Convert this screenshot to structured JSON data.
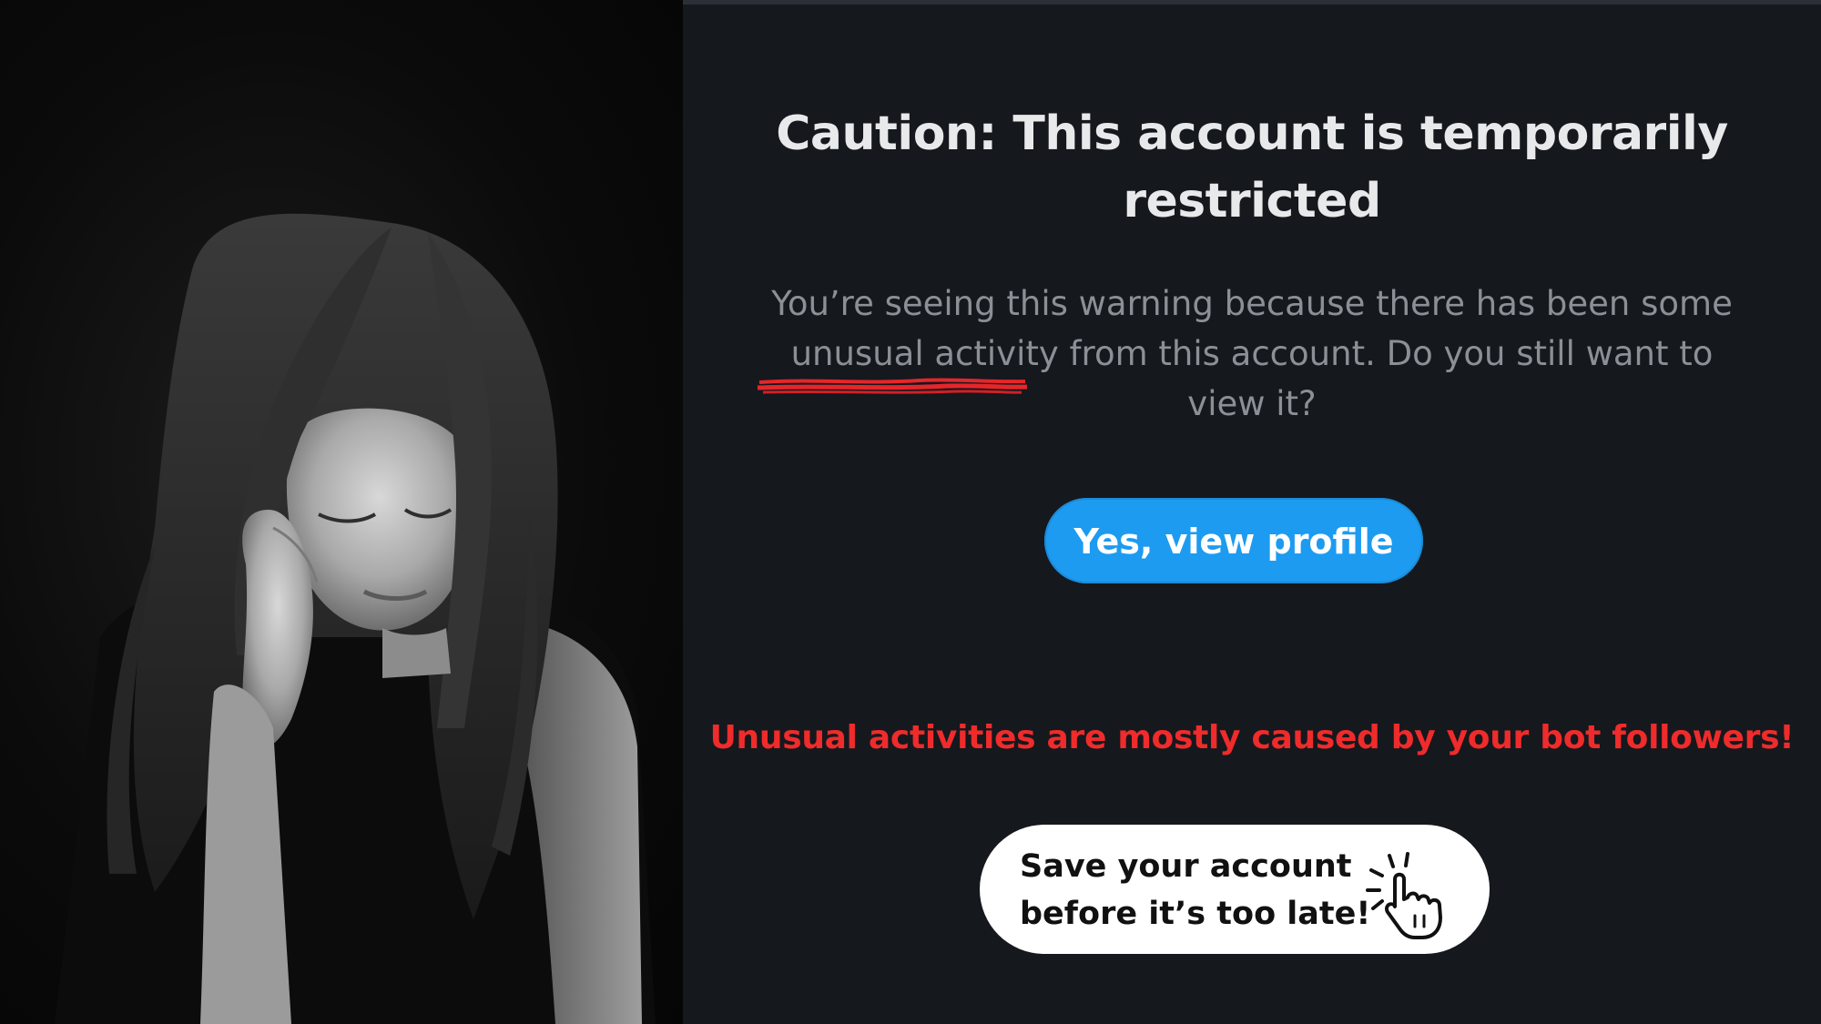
{
  "warning": {
    "title": "Caution: This account is temporarily restricted",
    "body_line1": "You’re seeing this warning because there has been some",
    "body_underlined": "unusual activity",
    "body_line2_rest": " from this account. Do you still want to",
    "body_line3": "view it?",
    "button_label": "Yes, view profile",
    "accent_color": "#1d9bf0"
  },
  "promo": {
    "claim": "Unusual activities are mostly caused by your bot followers!",
    "claim_color": "#ef2b2b",
    "cta_line1": "Save your account",
    "cta_line2": "before it’s too late!",
    "cta_icon": "tap-hand-icon"
  },
  "photo": {
    "subject_icon": "sad-woman-photo"
  }
}
